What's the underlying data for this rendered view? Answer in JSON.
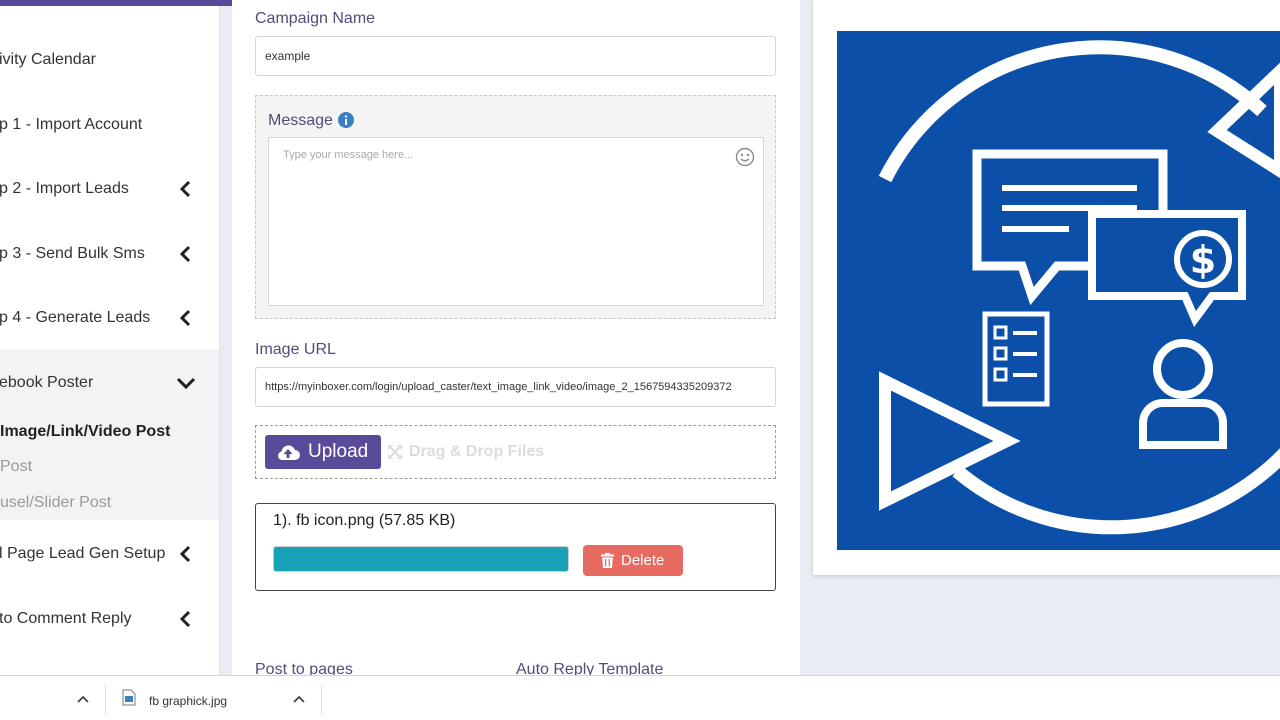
{
  "sidebar": {
    "items": [
      {
        "label": "ivity Calendar",
        "chevron": "none"
      },
      {
        "label": "p 1 - Import Account",
        "chevron": "none"
      },
      {
        "label": "p 2 - Import Leads",
        "chevron": "left"
      },
      {
        "label": "p 3 - Send Bulk Sms",
        "chevron": "left"
      },
      {
        "label": "p 4 - Generate Leads",
        "chevron": "left"
      },
      {
        "label": "ebook Poster",
        "chevron": "down"
      },
      {
        "label": "l Page Lead Gen Setup",
        "chevron": "left"
      },
      {
        "label": "to Comment Reply",
        "chevron": "left"
      }
    ],
    "submenu": [
      {
        "label": "Image/Link/Video Post",
        "active": true
      },
      {
        "label": "Post",
        "active": false
      },
      {
        "label": "usel/Slider Post",
        "active": false
      }
    ]
  },
  "form": {
    "campaign_name_label": "Campaign Name",
    "campaign_name_value": "example",
    "message_label": "Message",
    "message_placeholder": "Type your message here...",
    "image_url_label": "Image URL",
    "image_url_value": "https://myinboxer.com/login/upload_caster/text_image_link_video/image_2_1567594335209372",
    "upload_label": "Upload",
    "drag_drop_label": "Drag & Drop Files",
    "file_name": "1). fb icon.png (57.85 KB)",
    "upload_progress_percent": 100,
    "delete_label": "Delete",
    "post_to_pages_label": "Post to pages",
    "auto_reply_label": "Auto Reply Template"
  },
  "downloads": {
    "file_name": "fb graphick.jpg"
  },
  "colors": {
    "brand_purple": "#5a4b9a",
    "progress_teal": "#17a2b8",
    "delete_red": "#e76b61",
    "preview_blue": "#0b4fa8",
    "label_purple": "#564a7a",
    "info_blue": "#3a7fc4"
  },
  "icons": {
    "chevron_left": "chevron-left-icon",
    "chevron_down": "chevron-down-icon",
    "info": "info-icon",
    "smiley": "smiley-icon",
    "upload": "cloud-upload-icon",
    "drag": "move-icon",
    "delete": "trash-icon",
    "file": "image-file-icon",
    "caret_up": "caret-up-icon"
  }
}
